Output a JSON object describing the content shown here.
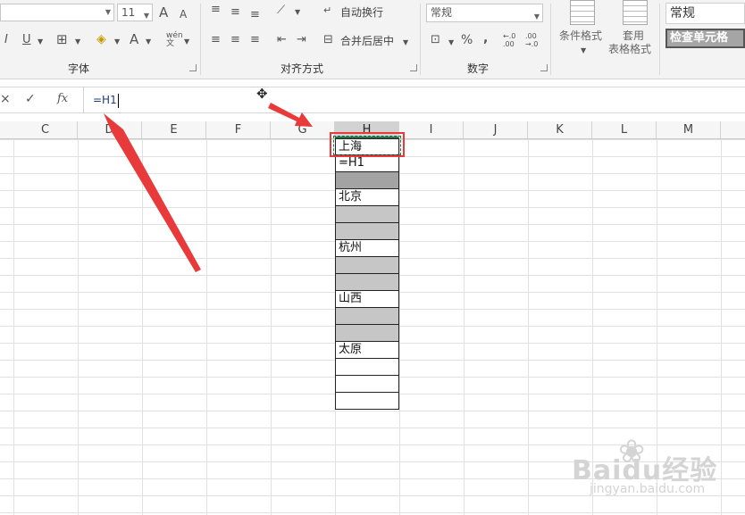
{
  "ribbon": {
    "font_size": "11",
    "font_group_label": "字体",
    "alignment_group_label": "对齐方式",
    "number_group_label": "数字",
    "wrap_text_label": "自动换行",
    "merge_center_label": "合并后居中",
    "number_format_value": "常规",
    "conditional_format_label": "条件格式",
    "table_format_label_1": "套用",
    "table_format_label_2": "表格格式",
    "style_normal_label": "常规",
    "style_check_cell_label": "检查单元格",
    "percent_symbol": "%",
    "comma_symbol": ",",
    "dec_increase": "←.0 .00",
    "dec_decrease": ".00 →.0",
    "bold_underline": "I",
    "underline": "U",
    "font_color_a": "A",
    "grow_font": "A",
    "shrink_font": "A",
    "wen_label": "wén 文"
  },
  "formula_bar": {
    "cancel_symbol": "×",
    "enter_symbol": "✓",
    "fx_label": "fx",
    "content": "=H1"
  },
  "columns": [
    "C",
    "D",
    "E",
    "F",
    "G",
    "H",
    "I",
    "J",
    "K",
    "L",
    "M"
  ],
  "selected_column": "H",
  "cells": [
    {
      "value": "上海",
      "fill": "white"
    },
    {
      "value": "=H1",
      "fill": "white"
    },
    {
      "value": "",
      "fill": "dark"
    },
    {
      "value": "北京",
      "fill": "white"
    },
    {
      "value": "",
      "fill": "gray"
    },
    {
      "value": "",
      "fill": "gray"
    },
    {
      "value": "杭州",
      "fill": "white"
    },
    {
      "value": "",
      "fill": "gray"
    },
    {
      "value": "",
      "fill": "gray"
    },
    {
      "value": "山西",
      "fill": "white"
    },
    {
      "value": "",
      "fill": "gray"
    },
    {
      "value": "",
      "fill": "gray"
    },
    {
      "value": "太原",
      "fill": "white"
    },
    {
      "value": "",
      "fill": "white"
    },
    {
      "value": "",
      "fill": "white"
    },
    {
      "value": "",
      "fill": "white"
    }
  ],
  "watermark": {
    "brand": "Baidu经验",
    "url": "jingyan.baidu.com"
  },
  "colors": {
    "annotation_red": "#e83a3a",
    "excel_green": "#217346"
  }
}
